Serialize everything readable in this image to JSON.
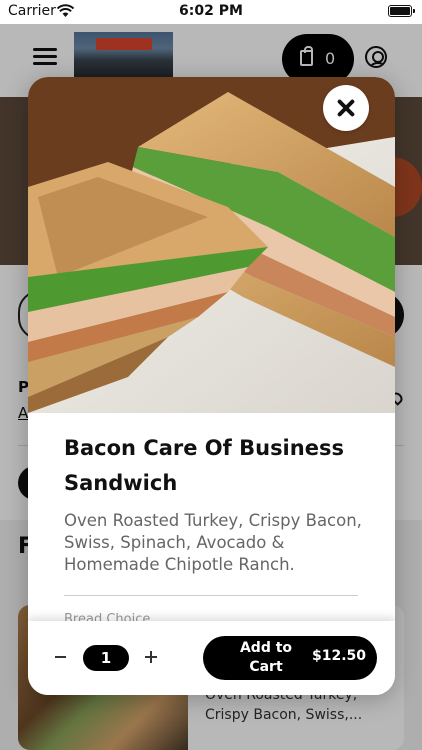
{
  "status_bar": {
    "carrier": "Carrier",
    "time": "6:02 PM"
  },
  "header": {
    "cart_count": "0"
  },
  "background": {
    "letter_p": "P",
    "letter_a": "A",
    "letter_f": "F",
    "card_description": "Oven Roasted Turkey, Crispy Bacon, Swiss,..."
  },
  "modal": {
    "title": "Bacon Care Of Business Sandwich",
    "description": "Oven Roasted Turkey, Crispy Bacon, Swiss, Spinach, Avocado & Homemade Chipotle Ranch.",
    "section_peek": "Bread Choice",
    "quantity": "1",
    "add_to_cart_label": "Add to Cart",
    "price": "$12.50"
  },
  "colors": {
    "primary": "#000000",
    "text": "#111111",
    "muted_text": "#666666"
  },
  "icons": [
    "wifi-icon",
    "battery-icon",
    "menu-icon",
    "bag-icon",
    "profile-icon",
    "close-icon",
    "minus-icon",
    "plus-icon"
  ]
}
